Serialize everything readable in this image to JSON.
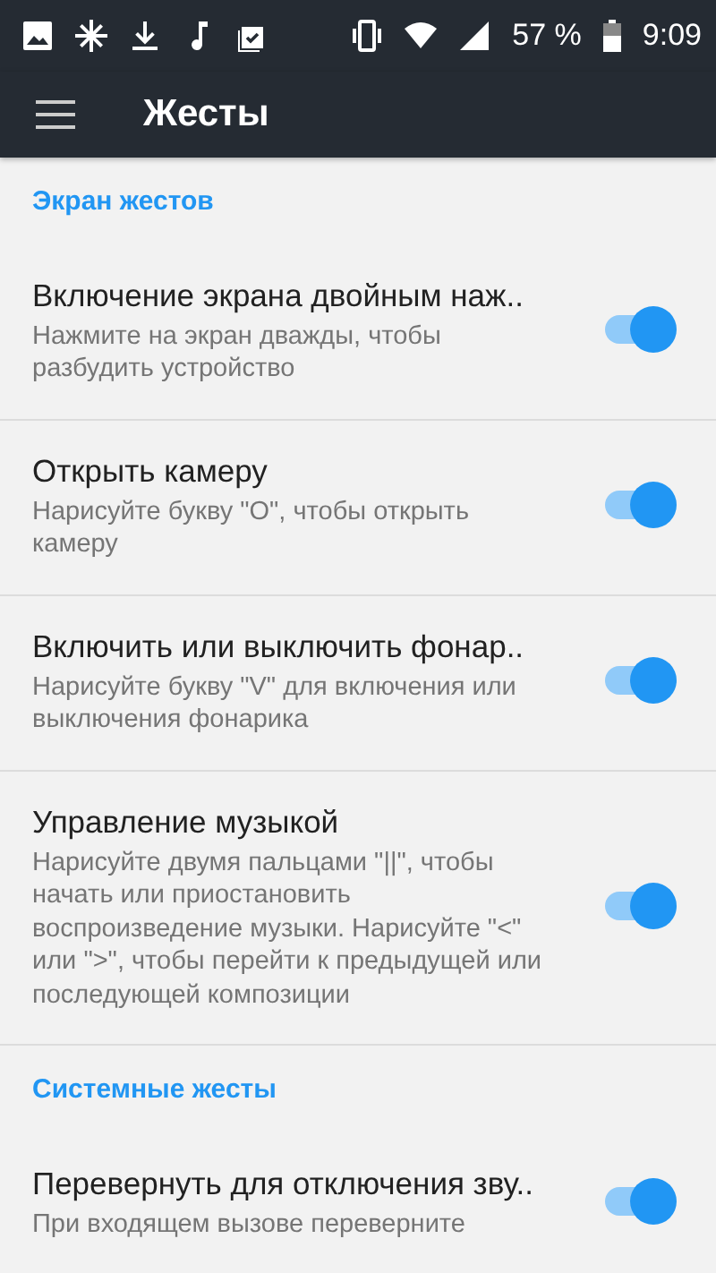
{
  "status_bar": {
    "battery_percent": "57 %",
    "time": "9:09"
  },
  "toolbar": {
    "title": "Жесты"
  },
  "sections": [
    {
      "header": "Экран жестов",
      "items": [
        {
          "title": "Включение экрана двойным наж..",
          "summary": "Нажмите на экран дважды, чтобы разбудить устройство",
          "on": true
        },
        {
          "title": "Открыть камеру",
          "summary": "Нарисуйте букву \"O\", чтобы открыть камеру",
          "on": true
        },
        {
          "title": "Включить или выключить фонар..",
          "summary": "Нарисуйте букву \"V\" для включения или выключения фонарика",
          "on": true
        },
        {
          "title": "Управление музыкой",
          "summary": "Нарисуйте двумя пальцами \"||\", чтобы начать или приостановить воспроизведение музыки. Нарисуйте \"<\" или \">\", чтобы перейти к предыдущей или последующей композиции",
          "on": true
        }
      ]
    },
    {
      "header": "Системные жесты",
      "items": [
        {
          "title": "Перевернуть для отключения зву..",
          "summary": "При входящем вызове переверните",
          "on": true
        }
      ]
    }
  ]
}
